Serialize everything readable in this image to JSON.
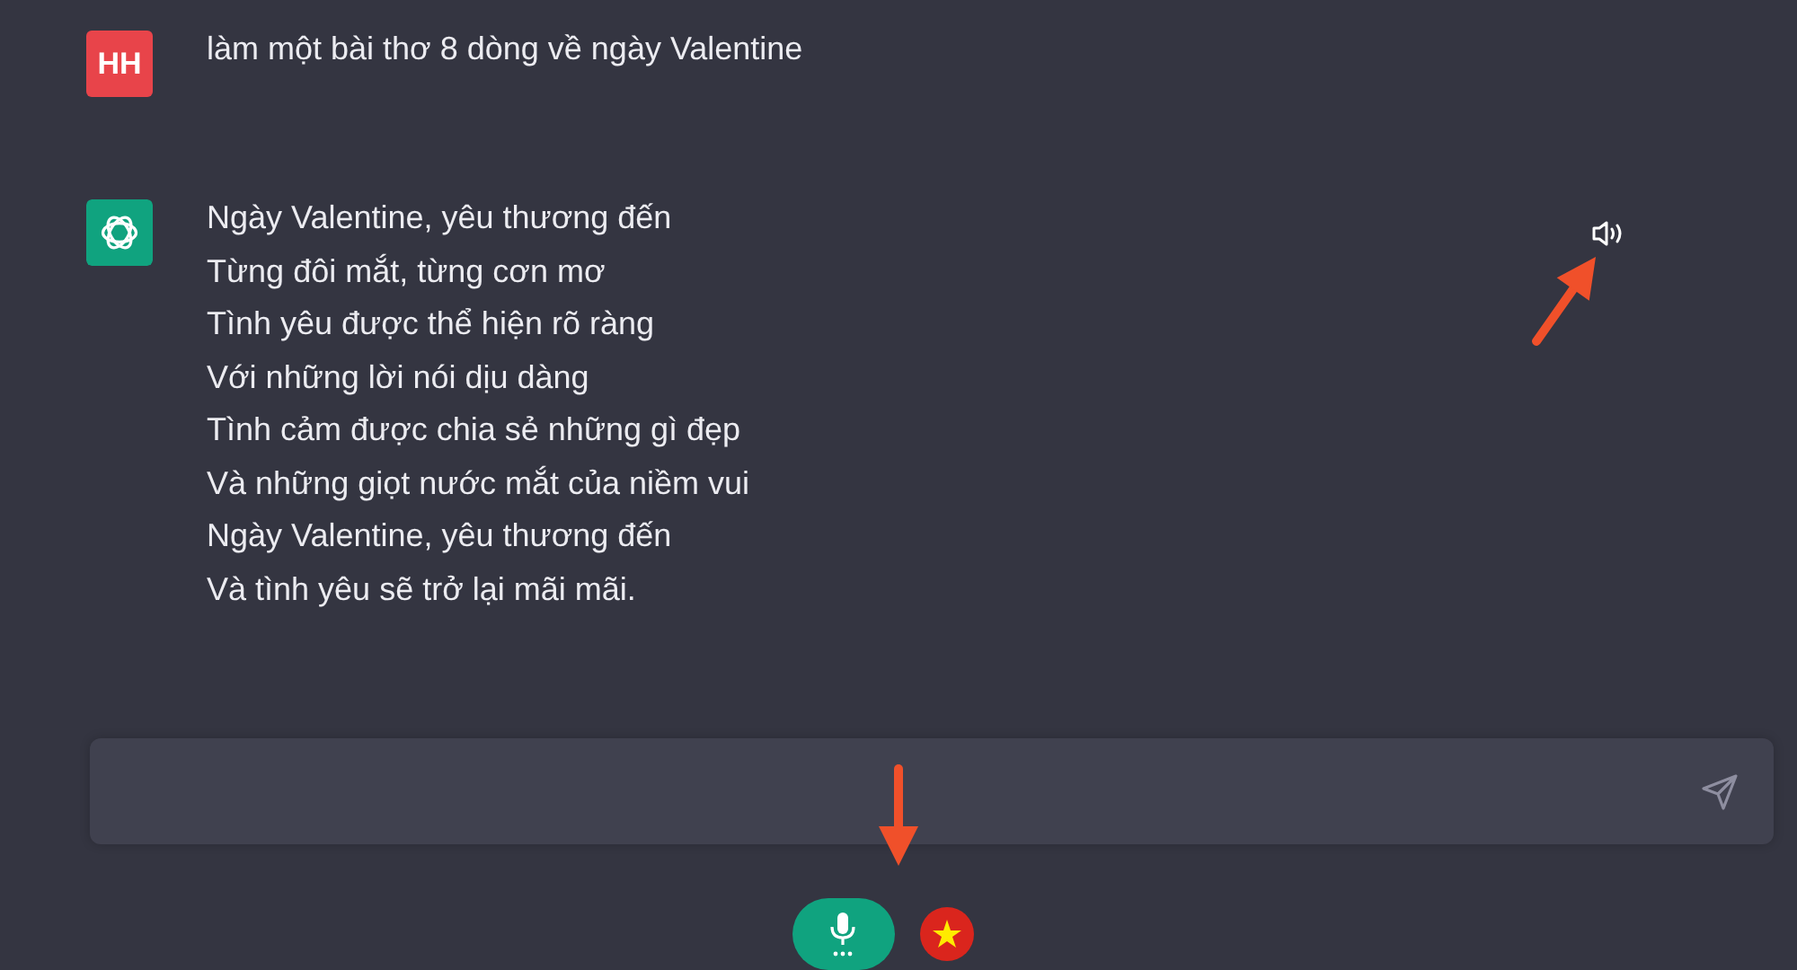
{
  "messages": [
    {
      "kind": "user",
      "avatar": "HH",
      "lines": [
        "làm một bài thơ 8 dòng về ngày Valentine"
      ]
    },
    {
      "kind": "assistant",
      "lines": [
        "Ngày Valentine, yêu thương đến",
        "Từng đôi mắt, từng cơn mơ",
        "Tình yêu được thể hiện rõ ràng",
        "Với những lời nói dịu dàng",
        "Tình cảm được chia sẻ những gì đẹp",
        "Và những giọt nước mắt của niềm vui",
        "Ngày Valentine, yêu thương đến",
        "Và tình yêu sẽ trở lại mãi mãi."
      ]
    }
  ]
}
